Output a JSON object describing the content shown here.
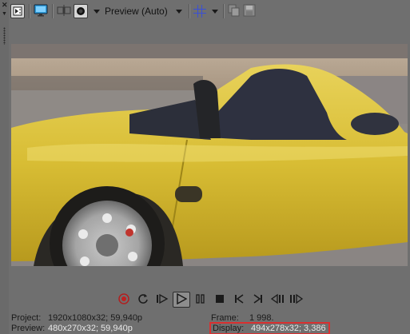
{
  "toolbar": {
    "preview_quality": "Preview (Auto)",
    "icons": [
      "properties-icon",
      "monitor-icon",
      "split-screen-icon",
      "overlay-icon",
      "grid-icon",
      "copy-frame-icon",
      "save-snapshot-icon"
    ]
  },
  "info": {
    "project_label": "Project:",
    "project_value": "1920x1080x32; 59,940p",
    "preview_label": "Preview:",
    "preview_value": "480x270x32; 59,940p",
    "frame_label": "Frame:",
    "frame_value": "1 998.",
    "display_label": "Display:",
    "display_value": "494x278x32; 3,386"
  },
  "colors": {
    "background": "#6f6f6f",
    "highlight_box": "#d93030",
    "record_red": "#c02020",
    "grid_blue": "#3a4fd6"
  }
}
